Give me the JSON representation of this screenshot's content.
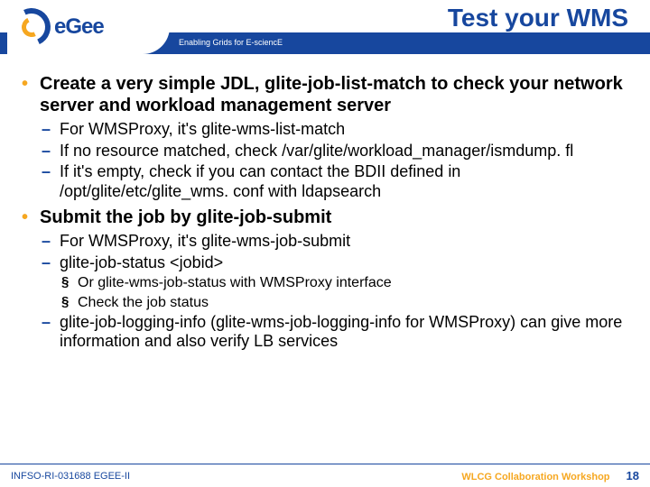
{
  "header": {
    "logo_text": "eGee",
    "tagline": "Enabling Grids for E-sciencE",
    "title": "Test your WMS"
  },
  "bullets": [
    {
      "text": "Create a very simple JDL, glite-job-list-match to check your network server and workload management server",
      "children": [
        {
          "text": "For WMSProxy, it's glite-wms-list-match"
        },
        {
          "text": "If no resource matched, check /var/glite/workload_manager/ismdump. fl"
        },
        {
          "text": "If it's empty, check if you can contact the BDII defined in /opt/glite/etc/glite_wms. conf with ldapsearch"
        }
      ]
    },
    {
      "text": "Submit the job by glite-job-submit",
      "children": [
        {
          "text": "For WMSProxy, it's glite-wms-job-submit"
        },
        {
          "text": "glite-job-status <jobid>",
          "children": [
            {
              "text": "Or glite-wms-job-status with WMSProxy interface"
            },
            {
              "text": "Check the job status"
            }
          ]
        },
        {
          "text": "glite-job-logging-info (glite-wms-job-logging-info for WMSProxy) can give more information and also verify LB services"
        }
      ]
    }
  ],
  "footer": {
    "left": "INFSO-RI-031688 EGEE-II",
    "center": "WLCG Collaboration Workshop",
    "page": "18"
  }
}
